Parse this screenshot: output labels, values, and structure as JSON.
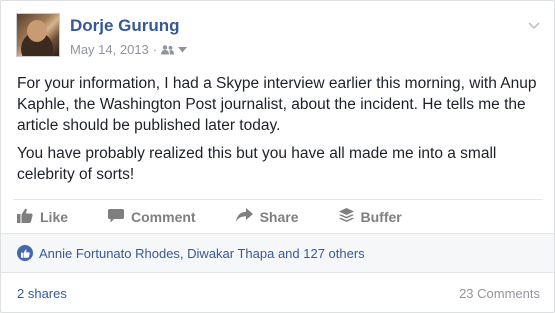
{
  "post": {
    "author": "Dorje Gurung",
    "date": "May 14, 2013",
    "separator": "·",
    "audience_icon": "friends-icon",
    "paragraphs": [
      "For your information, I had a Skype interview earlier this morning, with Anup Kaphle, the Washington Post journalist, about the incident. He tells me the article should be published later today.",
      "You have probably realized this but you have all made me into a small celebrity of sorts!"
    ]
  },
  "actions": {
    "like": "Like",
    "comment": "Comment",
    "share": "Share",
    "buffer": "Buffer"
  },
  "likes": {
    "text": "Annie Fortunato Rhodes, Diwakar Thapa and 127 others"
  },
  "footer": {
    "shares": "2 shares",
    "comments": "23 Comments"
  },
  "colors": {
    "link": "#365899",
    "muted": "#90949c",
    "action": "#7f7f7f",
    "like_badge": "#4267b2"
  }
}
